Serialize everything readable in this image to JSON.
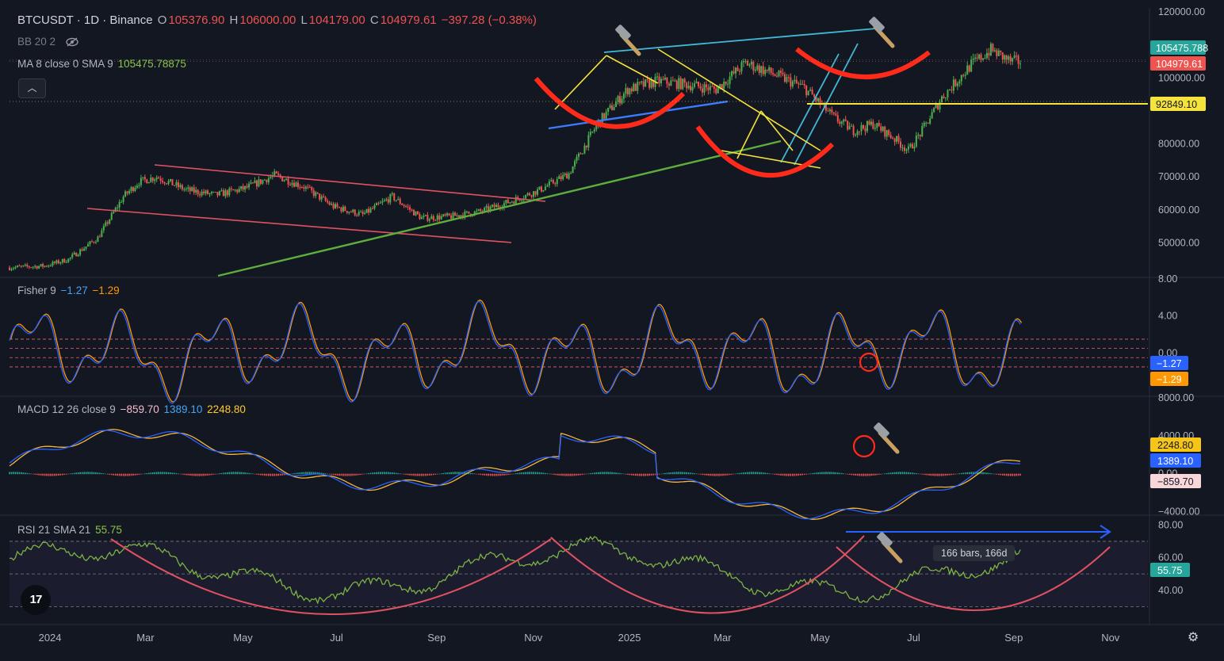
{
  "header": {
    "symbol": "BTCUSDT · 1D · Binance",
    "o_label": "O",
    "o_value": "105376.90",
    "h_label": "H",
    "h_value": "106000.00",
    "l_label": "L",
    "l_value": "104179.00",
    "c_label": "C",
    "c_value": "104979.61",
    "change": "−397.28 (−0.38%)"
  },
  "indicators": {
    "bb": "BB 20 2",
    "ma": "MA 8 close 0 SMA 9",
    "ma_value": "105475.78875",
    "fisher": "Fisher 9",
    "fisher_v1": "−1.27",
    "fisher_v2": "−1.29",
    "macd": "MACD 12 26 close 9",
    "macd_v1": "−859.70",
    "macd_v2": "1389.10",
    "macd_v3": "2248.80",
    "rsi": "RSI 21 SMA 21",
    "rsi_value": "55.75"
  },
  "colors": {
    "background": "#131722",
    "up": "#26a69a",
    "down": "#ef5350",
    "price_candle_up": "#4caf50",
    "fisher_blue": "#2962ff",
    "fisher_orange": "#ff9800",
    "rsi": "#7cb342",
    "red_curve": "#ff2a1a",
    "yellow_line": "#f5e23b",
    "cyan_line": "#42b8d8",
    "green_trend": "#5dae3c",
    "blue_line": "#3d7bff"
  },
  "chart_data": {
    "type": "candlestick",
    "x_ticks": [
      "2024",
      "Mar",
      "May",
      "Jul",
      "Sep",
      "Nov",
      "2025",
      "Mar",
      "May",
      "Jul",
      "Sep",
      "Nov"
    ],
    "price_panel": {
      "y_ticks": [
        "120000.00",
        "100000.00",
        "80000.00",
        "70000.00",
        "60000.00",
        "50000.00"
      ],
      "ylim": [
        40000,
        120000
      ],
      "badges": [
        {
          "value": "105475.788",
          "color": "#26a69a",
          "y": 105475.79
        },
        {
          "value": "104979.61",
          "color": "#ef5350",
          "y": 104979.61
        },
        {
          "value": "92849.10",
          "color": "#f5e23b",
          "y": 92849.1
        }
      ],
      "approx_close_path": [
        [
          0,
          42500
        ],
        [
          18,
          43000
        ],
        [
          30,
          45000
        ],
        [
          45,
          51500
        ],
        [
          58,
          64000
        ],
        [
          66,
          68500
        ],
        [
          75,
          70000
        ],
        [
          90,
          66000
        ],
        [
          105,
          64500
        ],
        [
          120,
          66500
        ],
        [
          135,
          70500
        ],
        [
          150,
          67000
        ],
        [
          165,
          61000
        ],
        [
          180,
          58500
        ],
        [
          195,
          64000
        ],
        [
          210,
          57500
        ],
        [
          225,
          58000
        ],
        [
          240,
          59500
        ],
        [
          255,
          62500
        ],
        [
          270,
          66000
        ],
        [
          285,
          71000
        ],
        [
          300,
          86500
        ],
        [
          315,
          96500
        ],
        [
          330,
          99000
        ],
        [
          345,
          98000
        ],
        [
          360,
          96500
        ],
        [
          375,
          104500
        ],
        [
          390,
          101000
        ],
        [
          405,
          97000
        ],
        [
          420,
          88000
        ],
        [
          430,
          84000
        ],
        [
          440,
          86000
        ],
        [
          450,
          82000
        ],
        [
          458,
          78000
        ],
        [
          465,
          84000
        ],
        [
          475,
          94000
        ],
        [
          490,
          104000
        ],
        [
          500,
          108500
        ],
        [
          510,
          105000
        ],
        [
          515,
          104979.61
        ]
      ]
    },
    "fisher_panel": {
      "y_ticks": [
        "8.00",
        "4.00",
        "0.00"
      ],
      "ylim": [
        -4,
        8
      ],
      "badges": [
        {
          "value": "−1.27",
          "color": "#2962ff"
        },
        {
          "value": "−1.29",
          "color": "#ff9800"
        }
      ]
    },
    "macd_panel": {
      "y_ticks": [
        "8000.00",
        "4000.00",
        "0.00",
        "−4000.00"
      ],
      "ylim": [
        -4000,
        8000
      ],
      "badges": [
        {
          "value": "2248.80",
          "color": "#f5c518"
        },
        {
          "value": "1389.10",
          "color": "#2962ff"
        },
        {
          "value": "−859.70",
          "color": "#f8d7da"
        }
      ]
    },
    "rsi_panel": {
      "y_ticks": [
        "80.00",
        "60.00",
        "40.00"
      ],
      "ylim": [
        20,
        85
      ],
      "badges": [
        {
          "value": "55.75",
          "color": "#26a69a"
        }
      ],
      "measure_label": "166 bars, 166d"
    }
  }
}
